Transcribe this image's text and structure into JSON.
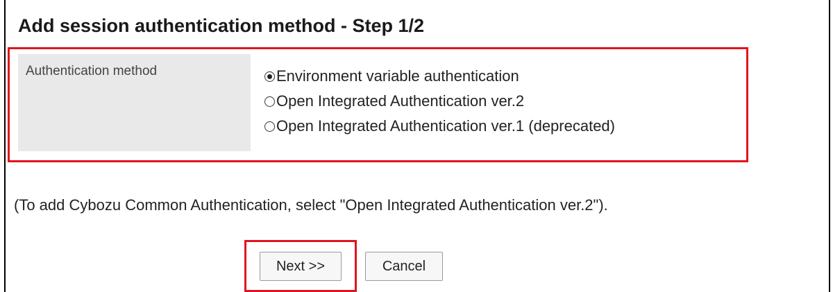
{
  "page": {
    "title": "Add session authentication method - Step 1/2"
  },
  "form": {
    "method_label": "Authentication method",
    "options": [
      {
        "label": "Environment variable authentication",
        "selected": true
      },
      {
        "label": "Open Integrated Authentication ver.2",
        "selected": false
      },
      {
        "label": "Open Integrated Authentication ver.1 (deprecated)",
        "selected": false
      }
    ],
    "note": "(To add Cybozu Common Authentication, select \"Open Integrated Authentication ver.2\")."
  },
  "buttons": {
    "next_label": "Next >>",
    "cancel_label": "Cancel"
  },
  "colors": {
    "highlight": "#e0141e",
    "label_cell_bg": "#e9e9e9"
  }
}
